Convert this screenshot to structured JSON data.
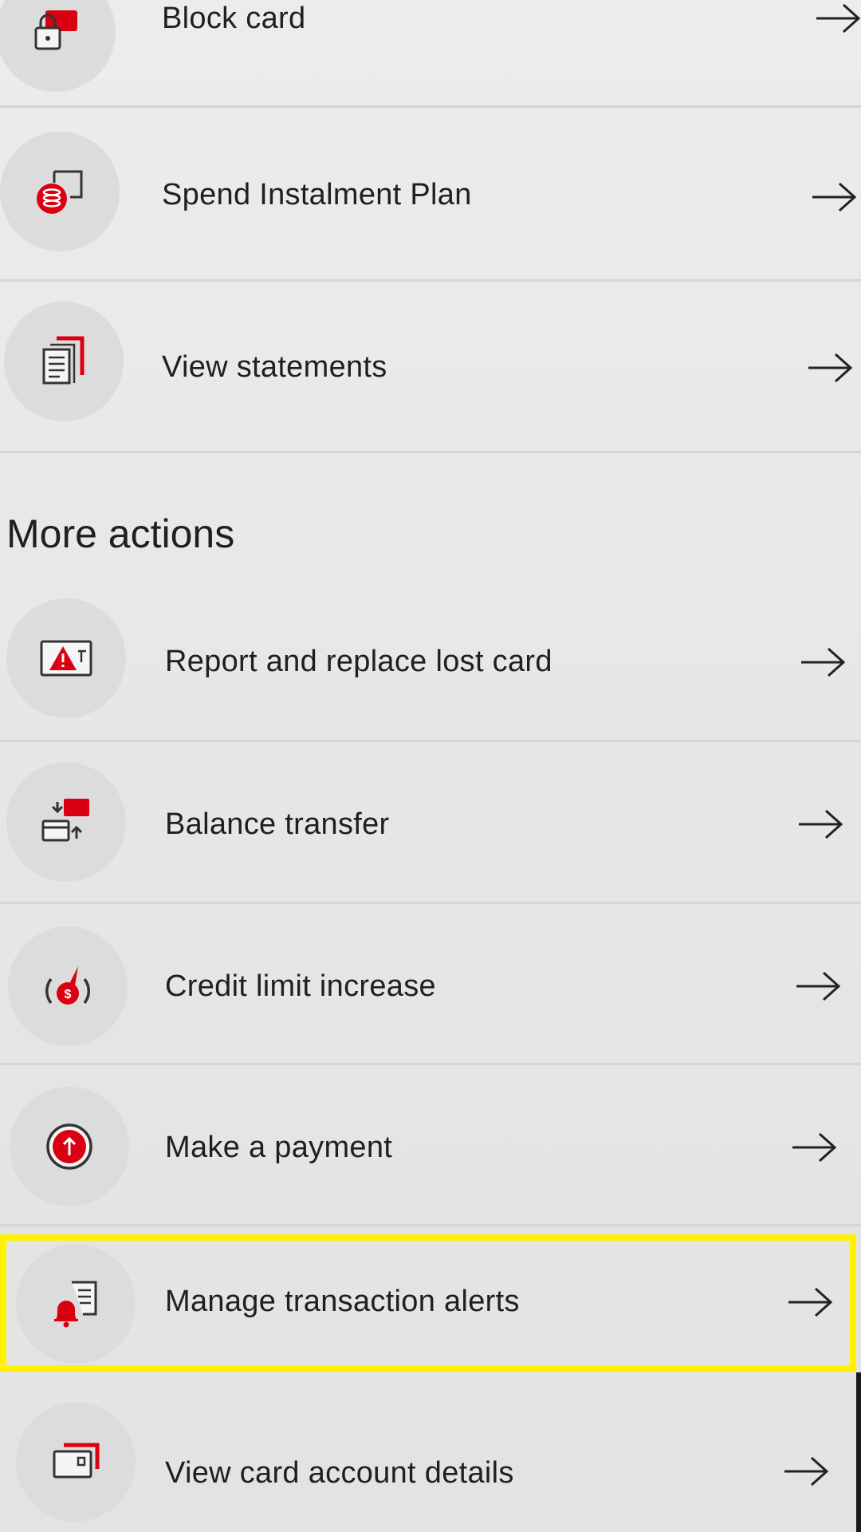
{
  "colors": {
    "accent": "#db0011",
    "highlight": "#fff200",
    "background": "#e9e9e9"
  },
  "top_items": [
    {
      "label": "Block card",
      "icon": "lock-card-icon"
    },
    {
      "label": "Spend Instalment Plan",
      "icon": "coins-card-icon"
    },
    {
      "label": "View statements",
      "icon": "statement-document-icon"
    }
  ],
  "more_actions": {
    "title": "More actions",
    "items": [
      {
        "label": "Report and replace lost card",
        "icon": "warning-card-icon"
      },
      {
        "label": "Balance transfer",
        "icon": "transfer-cards-icon"
      },
      {
        "label": "Credit limit increase",
        "icon": "dollar-gauge-icon"
      },
      {
        "label": "Make a payment",
        "icon": "payment-up-arrow-icon"
      },
      {
        "label": "Manage transaction alerts",
        "icon": "bell-alert-icon",
        "highlighted": true
      },
      {
        "label": "View card account details",
        "icon": "card-details-icon"
      }
    ]
  }
}
